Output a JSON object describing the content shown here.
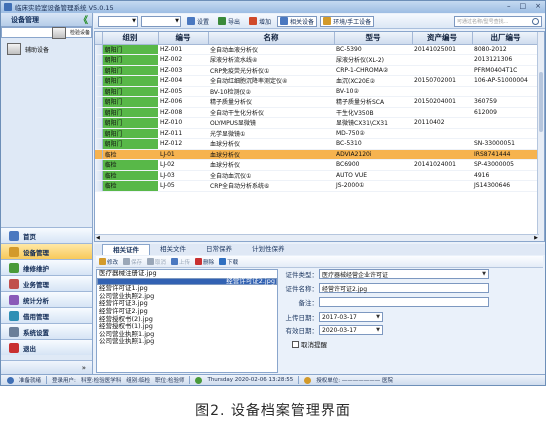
{
  "window": {
    "title": "临床实验室设备管理系统 V5.0.15",
    "controls": [
      "–",
      "□",
      "×"
    ]
  },
  "leftnav": {
    "header": "设备管理",
    "collapse_glyph": "《",
    "subitems": [
      {
        "label": "检验设备"
      },
      {
        "label": "辅助设备"
      }
    ],
    "nav": [
      {
        "label": "首页",
        "color": "#4a78c0"
      },
      {
        "label": "设备管理",
        "color": "#d39a2a",
        "active": true
      },
      {
        "label": "维修维护",
        "color": "#4a9a3a"
      },
      {
        "label": "业务管理",
        "color": "#c0504d"
      },
      {
        "label": "统计分析",
        "color": "#8a5ab8"
      },
      {
        "label": "借用管理",
        "color": "#2f8fb5"
      },
      {
        "label": "系统设置",
        "color": "#6b7f99"
      },
      {
        "label": "退出",
        "color": "#c93030"
      }
    ],
    "more": "»"
  },
  "toolbar": {
    "filter1_arrow": "▼",
    "filter2_arrow": "▼",
    "buttons": [
      {
        "label": "设置",
        "color": "#4a78c0"
      },
      {
        "label": "导出",
        "color": "#3a8a3a"
      },
      {
        "label": "增加",
        "color": "#d04a2a"
      }
    ],
    "boxed_buttons": [
      {
        "label": "相关设备",
        "color": "#4a78c0"
      },
      {
        "label": "环境/手工设备",
        "color": "#d39a2a"
      }
    ],
    "search_placeholder": "可通过名称/型号查找..."
  },
  "table": {
    "columns": [
      "组别",
      "编号",
      "名称",
      "型号",
      "资产编号",
      "出厂编号"
    ],
    "rows": [
      [
        "朝阳门",
        "HZ-001",
        "全自动血液分析仪",
        "BC-5390",
        "20141025001",
        "8080-2012"
      ],
      [
        "朝阳门",
        "HZ-002",
        "尿液分析流水线④",
        "尿液分析仪(XL-2)",
        "",
        "2013121306"
      ],
      [
        "朝阳门",
        "HZ-003",
        "CRP免疫荧光分析仪①",
        "CRP-1-CHROMA②",
        "",
        "PFRM0404T1C"
      ],
      [
        "朝阳门",
        "HZ-004",
        "全自动红细胞沉降率测定仪④",
        "血沉(XC20E②",
        "20150702001",
        "106-AP-51000004"
      ],
      [
        "朝阳门",
        "HZ-005",
        "BV-10检测仪②",
        "BV-10②",
        "",
        ""
      ],
      [
        "朝阳门",
        "HZ-006",
        "精子质量分析仪",
        "精子质量分析SCA",
        "20150204001",
        "360759"
      ],
      [
        "朝阳门",
        "HZ-008",
        "全自动干生化分析仪",
        "干生化V350B",
        "",
        "612009"
      ],
      [
        "朝阳门",
        "HZ-010",
        "OLYMPUS显微镜",
        "显微镜CX31\\CX31",
        "20110402",
        ""
      ],
      [
        "朝阳门",
        "HZ-011",
        "光学显微镜①",
        "MD-750②",
        "",
        ""
      ],
      [
        "朝阳门",
        "HZ-012",
        "血球分析仪",
        "BC-5310",
        "",
        "SN-33000051"
      ],
      [
        "临检",
        "LJ-01",
        "血球分析仪",
        "ADVIA2120i",
        "",
        "IRS8741444"
      ],
      [
        "临检",
        "LJ-02",
        "血球分析仪",
        "BC6900",
        "20141024001",
        "SP-43000005"
      ],
      [
        "临检",
        "LJ-03",
        "全自动血沉仪①",
        "AUTO VUE",
        "",
        "4916"
      ],
      [
        "临检",
        "LJ-05",
        "CRP全自动分析系统⑥",
        "JS-2000①",
        "",
        "JS14300646"
      ]
    ],
    "highlight_index": 10,
    "hscroll_arrows": [
      "◀",
      "▶"
    ]
  },
  "tabs": [
    {
      "label": "相关证件",
      "active": true
    },
    {
      "label": "相关文件"
    },
    {
      "label": "日常保养"
    },
    {
      "label": "计划性保养"
    }
  ],
  "subtoolbar": [
    {
      "label": "修改",
      "color": "#d39a2a"
    },
    {
      "label": "保存",
      "color": "#9aa7b8",
      "disabled": true
    },
    {
      "label": "取消",
      "color": "#9aa7b8",
      "disabled": true
    },
    {
      "label": "上传",
      "color": "#4a78c0",
      "disabled": true
    },
    {
      "label": "删除",
      "color": "#c93030"
    },
    {
      "label": "下载",
      "color": "#2f6fc0"
    }
  ],
  "cert_list": {
    "items": [
      "医疗器械注册证.jpg",
      "经营许可证2.jpg",
      "经营许可证1.jpg",
      "公司营业执照2.jpg",
      "经营许可证3.jpg",
      "经营许可证2.jpg",
      "经营授权书(2).jpg",
      "经营授权书(1).jpg",
      "公司营业执照1.jpg",
      "公司营业执照1.jpg"
    ],
    "selected_index": 1
  },
  "form": {
    "cert_type_label": "证件类型：",
    "cert_type_value": "医疗器械经营企业许可证",
    "cert_name_label": "证件名称：",
    "cert_name_value": "经营许可证2.jpg",
    "remark_label": "备注：",
    "remark_value": "",
    "upload_date_label": "上传日期：",
    "upload_date_value": "2017-03-17",
    "expiry_label": "有效日期：",
    "expiry_value": "2020-03-17",
    "cancel_remind_label": "取消提醒"
  },
  "status": {
    "ready": "准备就绪",
    "user": "登录用户: ",
    "dept": "科室:检验医学科",
    "group": "组别:临检",
    "role": "职位:检验师",
    "datetime": "Thursday 2020-02-06 13:28:55",
    "auth": "授权单位: ——————— 医院"
  },
  "caption": "图2. 设备档案管理界面"
}
